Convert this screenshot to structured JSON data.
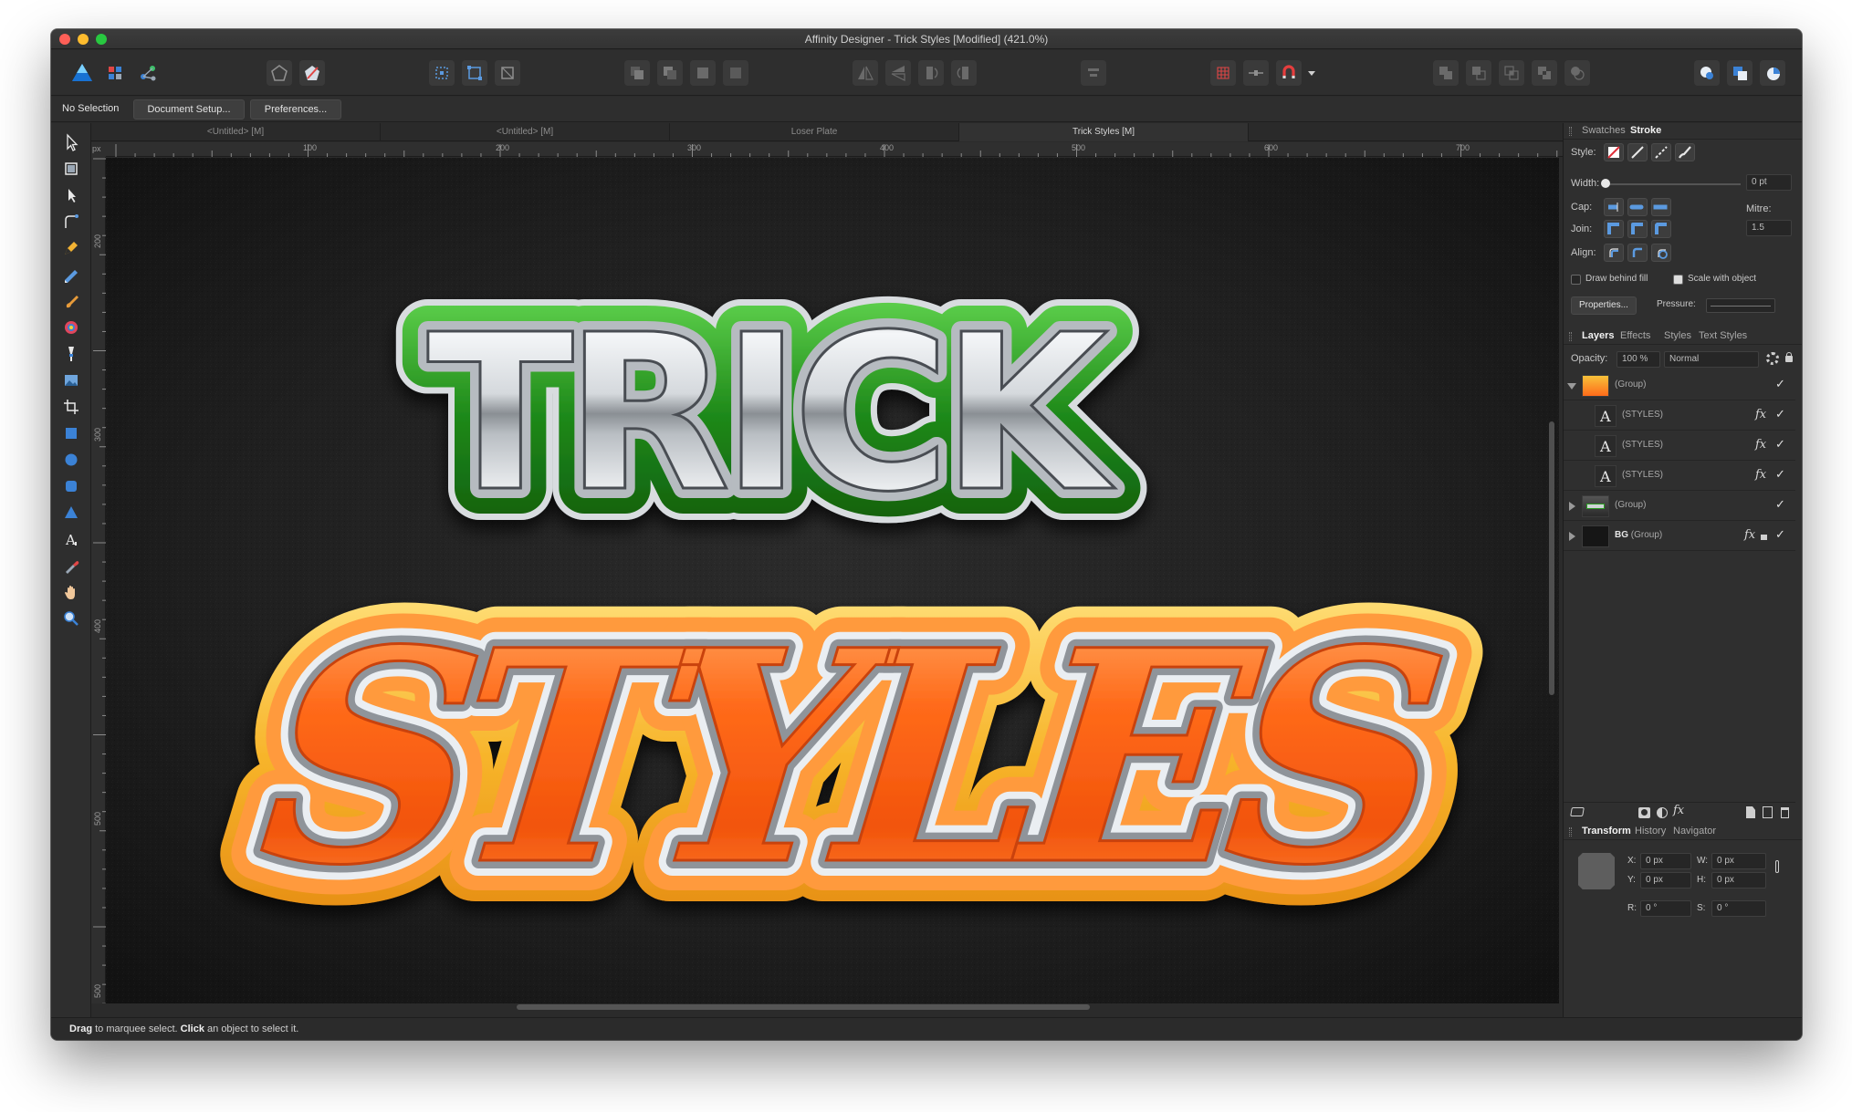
{
  "window": {
    "title": "Affinity Designer - Trick Styles [Modified] (421.0%)"
  },
  "colors": {
    "close": "#fe5f57",
    "minimize": "#febc2e",
    "zoom": "#28c840",
    "accent": "#3b82d6",
    "trick_outline": "#2a9a22",
    "styles_orange": "#ff6b1a",
    "styles_yellow": "#f7c23a"
  },
  "context": {
    "selection": "No Selection",
    "document_setup": "Document Setup...",
    "preferences": "Preferences..."
  },
  "doc_tabs": [
    {
      "label": "<Untitled> [M]",
      "active": false
    },
    {
      "label": "<Untitled> [M]",
      "active": false
    },
    {
      "label": "Loser Plate",
      "active": false
    },
    {
      "label": "Trick Styles [M]",
      "active": true
    }
  ],
  "ruler": {
    "unit": "px",
    "top": [
      "100",
      "200",
      "300",
      "400",
      "500",
      "600",
      "700"
    ],
    "left": [
      "200",
      "300",
      "400",
      "500",
      "500"
    ]
  },
  "artwork": {
    "line1": "TRICK",
    "line2": "STYLES"
  },
  "status": {
    "bold1": "Drag",
    "text1": " to marquee select. ",
    "bold2": "Click",
    "text2": " an object to select it."
  },
  "stroke_panel": {
    "tabs": [
      "Swatches",
      "Stroke"
    ],
    "active_tab": "Stroke",
    "style_label": "Style:",
    "width_label": "Width:",
    "width_value": "0 pt",
    "cap_label": "Cap:",
    "join_label": "Join:",
    "align_label": "Align:",
    "mitre_label": "Mitre:",
    "mitre_value": "1.5",
    "draw_behind_fill": "Draw behind fill",
    "scale_with_object": "Scale with object",
    "properties": "Properties...",
    "pressure_label": "Pressure:"
  },
  "layers_panel": {
    "tabs": [
      "Layers",
      "Effects",
      "Styles",
      "Text Styles"
    ],
    "active_tab": "Layers",
    "opacity_label": "Opacity:",
    "opacity_value": "100 %",
    "blend_mode": "Normal",
    "layers": [
      {
        "name": "",
        "type": "(Group)",
        "expanded": true,
        "indent": 0,
        "fx": false
      },
      {
        "name": "",
        "type": "(STYLES)",
        "indent": 1,
        "fx": true
      },
      {
        "name": "",
        "type": "(STYLES)",
        "indent": 1,
        "fx": true
      },
      {
        "name": "",
        "type": "(STYLES)",
        "indent": 1,
        "fx": true
      },
      {
        "name": "",
        "type": "(Group)",
        "expanded": false,
        "indent": 0,
        "fx": false
      },
      {
        "name": "BG",
        "type": " (Group)",
        "expanded": false,
        "indent": 0,
        "fx": true
      }
    ]
  },
  "transform_panel": {
    "tabs": [
      "Transform",
      "History",
      "Navigator"
    ],
    "active_tab": "Transform",
    "x_label": "X:",
    "x_value": "0 px",
    "y_label": "Y:",
    "y_value": "0 px",
    "w_label": "W:",
    "w_value": "0 px",
    "h_label": "H:",
    "h_value": "0 px",
    "r_label": "R:",
    "r_value": "0 °",
    "s_label": "S:",
    "s_value": "0 °"
  }
}
